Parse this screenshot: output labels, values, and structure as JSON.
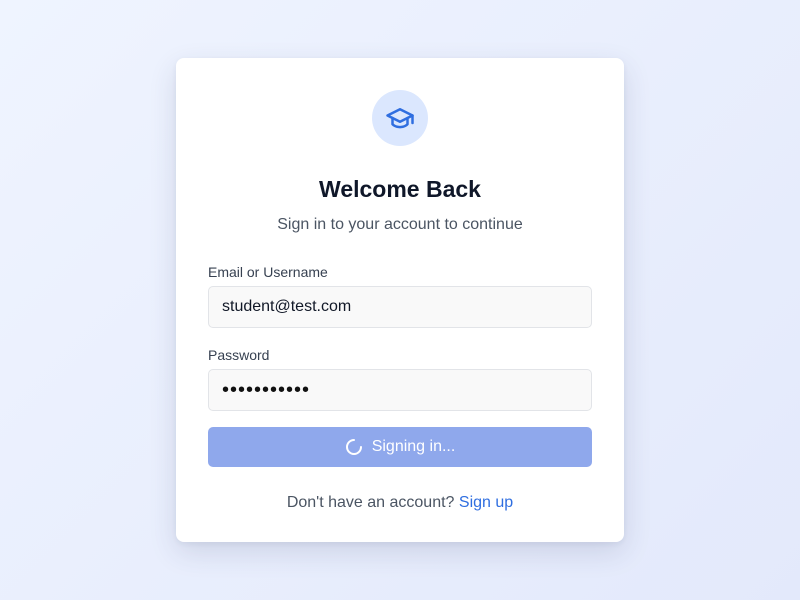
{
  "login": {
    "title": "Welcome Back",
    "subtitle": "Sign in to your account to continue",
    "email_label": "Email or Username",
    "email_value": "student@test.com",
    "password_label": "Password",
    "password_masked": "•••••••••••",
    "submit_label": "Signing in...",
    "submit_state": "loading",
    "footer_text": "Don't have an account?",
    "signup_link": "Sign up",
    "logo_icon": "graduation-cap-icon",
    "spinner_icon": "loading-spinner-icon"
  },
  "colors": {
    "accent": "#2f6ee0",
    "button_loading_bg": "#8fa8ec",
    "logo_bg": "#dbe7fe"
  }
}
